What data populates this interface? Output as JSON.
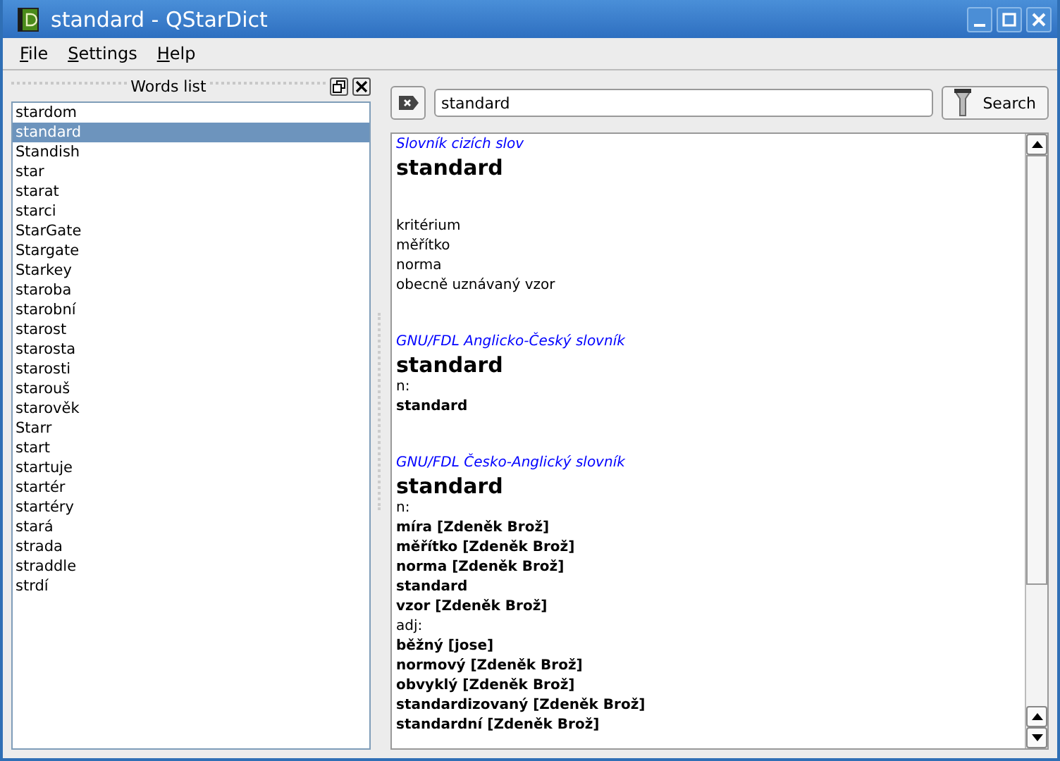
{
  "window": {
    "title": "standard - QStarDict"
  },
  "menu": [
    {
      "label": "File"
    },
    {
      "label": "Settings"
    },
    {
      "label": "Help"
    }
  ],
  "words_list": {
    "title": "Words list",
    "items": [
      {
        "label": "stardom",
        "selected": false
      },
      {
        "label": "standard",
        "selected": true
      },
      {
        "label": "Standish",
        "selected": false
      },
      {
        "label": "star",
        "selected": false
      },
      {
        "label": "starat",
        "selected": false
      },
      {
        "label": "starci",
        "selected": false
      },
      {
        "label": "StarGate",
        "selected": false
      },
      {
        "label": "Stargate",
        "selected": false
      },
      {
        "label": "Starkey",
        "selected": false
      },
      {
        "label": "staroba",
        "selected": false
      },
      {
        "label": "starobní",
        "selected": false
      },
      {
        "label": "starost",
        "selected": false
      },
      {
        "label": "starosta",
        "selected": false
      },
      {
        "label": "starosti",
        "selected": false
      },
      {
        "label": "starouš",
        "selected": false
      },
      {
        "label": "starověk",
        "selected": false
      },
      {
        "label": "Starr",
        "selected": false
      },
      {
        "label": "start",
        "selected": false
      },
      {
        "label": "startuje",
        "selected": false
      },
      {
        "label": "startér",
        "selected": false
      },
      {
        "label": "startéry",
        "selected": false
      },
      {
        "label": "stará",
        "selected": false
      },
      {
        "label": "strada",
        "selected": false
      },
      {
        "label": "straddle",
        "selected": false
      },
      {
        "label": "strdí",
        "selected": false
      }
    ]
  },
  "search": {
    "value": "standard",
    "button": "Search"
  },
  "article": [
    {
      "dictionary": "Slovník cizích slov",
      "headword": "standard",
      "lines": [
        {
          "text": "kritérium",
          "kind": "plain"
        },
        {
          "text": "měřítko",
          "kind": "plain"
        },
        {
          "text": "norma",
          "kind": "plain"
        },
        {
          "text": "obecně uznávaný vzor",
          "kind": "plain"
        }
      ]
    },
    {
      "dictionary": "GNU/FDL Anglicko-Český slovník",
      "headword": "standard",
      "lines": [
        {
          "text": "n:",
          "kind": "plain"
        },
        {
          "text": "standard",
          "kind": "bold"
        }
      ]
    },
    {
      "dictionary": "GNU/FDL Česko-Anglický slovník",
      "headword": "standard",
      "lines": [
        {
          "text": "n:",
          "kind": "plain"
        },
        {
          "text": "míra [Zdeněk Brož]",
          "kind": "bold"
        },
        {
          "text": "měřítko [Zdeněk Brož]",
          "kind": "bold"
        },
        {
          "text": "norma [Zdeněk Brož]",
          "kind": "bold"
        },
        {
          "text": "standard",
          "kind": "bold"
        },
        {
          "text": "vzor [Zdeněk Brož]",
          "kind": "bold"
        },
        {
          "text": "adj:",
          "kind": "plain"
        },
        {
          "text": "běžný [jose]",
          "kind": "bold"
        },
        {
          "text": "normový [Zdeněk Brož]",
          "kind": "bold"
        },
        {
          "text": "obvyklý [Zdeněk Brož]",
          "kind": "bold"
        },
        {
          "text": "standardizovaný [Zdeněk Brož]",
          "kind": "bold"
        },
        {
          "text": "standardní [Zdeněk Brož]",
          "kind": "bold"
        }
      ]
    }
  ]
}
